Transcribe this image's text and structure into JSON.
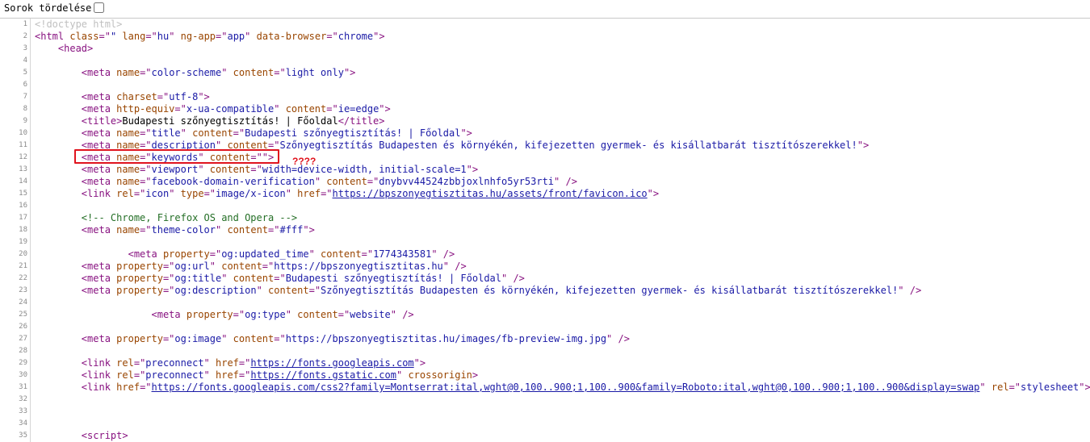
{
  "toolbar": {
    "wrap_label": "Sorok tördelése"
  },
  "lines": [
    [
      [
        "dt",
        "<!doctype html>"
      ]
    ],
    [
      [
        "t",
        "<html "
      ],
      [
        "an",
        "class"
      ],
      [
        "t",
        "=\""
      ],
      [
        "av",
        "\""
      ],
      [
        "t",
        " "
      ],
      [
        "an",
        "lang"
      ],
      [
        "t",
        "=\""
      ],
      [
        "av",
        "hu"
      ],
      [
        "t",
        "\" "
      ],
      [
        "an",
        "ng-app"
      ],
      [
        "t",
        "=\""
      ],
      [
        "av",
        "app"
      ],
      [
        "t",
        "\" "
      ],
      [
        "an",
        "data-browser"
      ],
      [
        "t",
        "=\""
      ],
      [
        "av",
        "chrome"
      ],
      [
        "t",
        "\">"
      ]
    ],
    [
      [
        "tx",
        "    "
      ],
      [
        "t",
        "<head>"
      ]
    ],
    [],
    [
      [
        "tx",
        "        "
      ],
      [
        "t",
        "<meta "
      ],
      [
        "an",
        "name"
      ],
      [
        "t",
        "=\""
      ],
      [
        "av",
        "color-scheme"
      ],
      [
        "t",
        "\" "
      ],
      [
        "an",
        "content"
      ],
      [
        "t",
        "=\""
      ],
      [
        "av",
        "light only"
      ],
      [
        "t",
        "\">"
      ]
    ],
    [],
    [
      [
        "tx",
        "        "
      ],
      [
        "t",
        "<meta "
      ],
      [
        "an",
        "charset"
      ],
      [
        "t",
        "=\""
      ],
      [
        "av",
        "utf-8"
      ],
      [
        "t",
        "\">"
      ]
    ],
    [
      [
        "tx",
        "        "
      ],
      [
        "t",
        "<meta "
      ],
      [
        "an",
        "http-equiv"
      ],
      [
        "t",
        "=\""
      ],
      [
        "av",
        "x-ua-compatible"
      ],
      [
        "t",
        "\" "
      ],
      [
        "an",
        "content"
      ],
      [
        "t",
        "=\""
      ],
      [
        "av",
        "ie=edge"
      ],
      [
        "t",
        "\">"
      ]
    ],
    [
      [
        "tx",
        "        "
      ],
      [
        "t",
        "<title>"
      ],
      [
        "tx",
        "Budapesti szőnyegtisztítás! | Főoldal"
      ],
      [
        "t",
        "</title>"
      ]
    ],
    [
      [
        "tx",
        "        "
      ],
      [
        "t",
        "<meta "
      ],
      [
        "an",
        "name"
      ],
      [
        "t",
        "=\""
      ],
      [
        "av",
        "title"
      ],
      [
        "t",
        "\" "
      ],
      [
        "an",
        "content"
      ],
      [
        "t",
        "=\""
      ],
      [
        "av",
        "Budapesti szőnyegtisztítás! | Főoldal"
      ],
      [
        "t",
        "\">"
      ]
    ],
    [
      [
        "tx",
        "        "
      ],
      [
        "t",
        "<meta "
      ],
      [
        "an",
        "name"
      ],
      [
        "t",
        "=\""
      ],
      [
        "av",
        "description"
      ],
      [
        "t",
        "\" "
      ],
      [
        "an",
        "content"
      ],
      [
        "t",
        "=\""
      ],
      [
        "av",
        "Szőnyegtisztítás Budapesten és környékén, kifejezetten gyermek- és kisállatbarát tisztítószerekkel!"
      ],
      [
        "t",
        "\">"
      ]
    ],
    [
      [
        "tx",
        "        "
      ],
      [
        "t",
        "<meta "
      ],
      [
        "an",
        "name"
      ],
      [
        "t",
        "=\""
      ],
      [
        "av",
        "keywords"
      ],
      [
        "t",
        "\" "
      ],
      [
        "an",
        "content"
      ],
      [
        "t",
        "=\""
      ],
      [
        "av",
        ""
      ],
      [
        "t",
        "\">"
      ]
    ],
    [
      [
        "tx",
        "        "
      ],
      [
        "t",
        "<meta "
      ],
      [
        "an",
        "name"
      ],
      [
        "t",
        "=\""
      ],
      [
        "av",
        "viewport"
      ],
      [
        "t",
        "\" "
      ],
      [
        "an",
        "content"
      ],
      [
        "t",
        "=\""
      ],
      [
        "av",
        "width=device-width, initial-scale=1"
      ],
      [
        "t",
        "\">"
      ]
    ],
    [
      [
        "tx",
        "        "
      ],
      [
        "t",
        "<meta "
      ],
      [
        "an",
        "name"
      ],
      [
        "t",
        "=\""
      ],
      [
        "av",
        "facebook-domain-verification"
      ],
      [
        "t",
        "\" "
      ],
      [
        "an",
        "content"
      ],
      [
        "t",
        "=\""
      ],
      [
        "av",
        "dnybvv44524zbbjoxlnhfo5yr53rti"
      ],
      [
        "t",
        "\" />"
      ]
    ],
    [
      [
        "tx",
        "        "
      ],
      [
        "t",
        "<link "
      ],
      [
        "an",
        "rel"
      ],
      [
        "t",
        "=\""
      ],
      [
        "av",
        "icon"
      ],
      [
        "t",
        "\" "
      ],
      [
        "an",
        "type"
      ],
      [
        "t",
        "=\""
      ],
      [
        "av",
        "image/x-icon"
      ],
      [
        "t",
        "\" "
      ],
      [
        "an",
        "href"
      ],
      [
        "t",
        "=\""
      ],
      [
        "lk",
        "https://bpszonyegtisztitas.hu/assets/front/favicon.ico"
      ],
      [
        "t",
        "\">"
      ]
    ],
    [],
    [
      [
        "tx",
        "        "
      ],
      [
        "c",
        "<!-- Chrome, Firefox OS and Opera -->"
      ]
    ],
    [
      [
        "tx",
        "        "
      ],
      [
        "t",
        "<meta "
      ],
      [
        "an",
        "name"
      ],
      [
        "t",
        "=\""
      ],
      [
        "av",
        "theme-color"
      ],
      [
        "t",
        "\" "
      ],
      [
        "an",
        "content"
      ],
      [
        "t",
        "=\""
      ],
      [
        "av",
        "#fff"
      ],
      [
        "t",
        "\">"
      ]
    ],
    [],
    [
      [
        "tx",
        "                "
      ],
      [
        "t",
        "<meta "
      ],
      [
        "an",
        "property"
      ],
      [
        "t",
        "=\""
      ],
      [
        "av",
        "og:updated_time"
      ],
      [
        "t",
        "\" "
      ],
      [
        "an",
        "content"
      ],
      [
        "t",
        "=\""
      ],
      [
        "av",
        "1774343581"
      ],
      [
        "t",
        "\" />"
      ]
    ],
    [
      [
        "tx",
        "        "
      ],
      [
        "t",
        "<meta "
      ],
      [
        "an",
        "property"
      ],
      [
        "t",
        "=\""
      ],
      [
        "av",
        "og:url"
      ],
      [
        "t",
        "\" "
      ],
      [
        "an",
        "content"
      ],
      [
        "t",
        "=\""
      ],
      [
        "av",
        "https://bpszonyegtisztitas.hu"
      ],
      [
        "t",
        "\" />"
      ]
    ],
    [
      [
        "tx",
        "        "
      ],
      [
        "t",
        "<meta "
      ],
      [
        "an",
        "property"
      ],
      [
        "t",
        "=\""
      ],
      [
        "av",
        "og:title"
      ],
      [
        "t",
        "\" "
      ],
      [
        "an",
        "content"
      ],
      [
        "t",
        "=\""
      ],
      [
        "av",
        "Budapesti szőnyegtisztítás! | Főoldal"
      ],
      [
        "t",
        "\" />"
      ]
    ],
    [
      [
        "tx",
        "        "
      ],
      [
        "t",
        "<meta "
      ],
      [
        "an",
        "property"
      ],
      [
        "t",
        "=\""
      ],
      [
        "av",
        "og:description"
      ],
      [
        "t",
        "\" "
      ],
      [
        "an",
        "content"
      ],
      [
        "t",
        "=\""
      ],
      [
        "av",
        "Szőnyegtisztítás Budapesten és környékén, kifejezetten gyermek- és kisállatbarát tisztítószerekkel!"
      ],
      [
        "t",
        "\" />"
      ]
    ],
    [],
    [
      [
        "tx",
        "                    "
      ],
      [
        "t",
        "<meta "
      ],
      [
        "an",
        "property"
      ],
      [
        "t",
        "=\""
      ],
      [
        "av",
        "og:type"
      ],
      [
        "t",
        "\" "
      ],
      [
        "an",
        "content"
      ],
      [
        "t",
        "=\""
      ],
      [
        "av",
        "website"
      ],
      [
        "t",
        "\" />"
      ]
    ],
    [],
    [
      [
        "tx",
        "        "
      ],
      [
        "t",
        "<meta "
      ],
      [
        "an",
        "property"
      ],
      [
        "t",
        "=\""
      ],
      [
        "av",
        "og:image"
      ],
      [
        "t",
        "\" "
      ],
      [
        "an",
        "content"
      ],
      [
        "t",
        "=\""
      ],
      [
        "av",
        "https://bpszonyegtisztitas.hu/images/fb-preview-img.jpg"
      ],
      [
        "t",
        "\" />"
      ]
    ],
    [],
    [
      [
        "tx",
        "        "
      ],
      [
        "t",
        "<link "
      ],
      [
        "an",
        "rel"
      ],
      [
        "t",
        "=\""
      ],
      [
        "av",
        "preconnect"
      ],
      [
        "t",
        "\" "
      ],
      [
        "an",
        "href"
      ],
      [
        "t",
        "=\""
      ],
      [
        "lk",
        "https://fonts.googleapis.com"
      ],
      [
        "t",
        "\">"
      ]
    ],
    [
      [
        "tx",
        "        "
      ],
      [
        "t",
        "<link "
      ],
      [
        "an",
        "rel"
      ],
      [
        "t",
        "=\""
      ],
      [
        "av",
        "preconnect"
      ],
      [
        "t",
        "\" "
      ],
      [
        "an",
        "href"
      ],
      [
        "t",
        "=\""
      ],
      [
        "lk",
        "https://fonts.gstatic.com"
      ],
      [
        "t",
        "\" "
      ],
      [
        "an",
        "crossorigin"
      ],
      [
        "t",
        ">"
      ]
    ],
    [
      [
        "tx",
        "        "
      ],
      [
        "t",
        "<link "
      ],
      [
        "an",
        "href"
      ],
      [
        "t",
        "=\""
      ],
      [
        "lk",
        "https://fonts.googleapis.com/css2?family=Montserrat:ital,wght@0,100..900;1,100..900&family=Roboto:ital,wght@0,100..900;1,100..900&display=swap"
      ],
      [
        "t",
        "\" "
      ],
      [
        "an",
        "rel"
      ],
      [
        "t",
        "=\""
      ],
      [
        "av",
        "stylesheet"
      ],
      [
        "t",
        "\">"
      ]
    ],
    [],
    [],
    [],
    [
      [
        "tx",
        "        "
      ],
      [
        "t",
        "<script>"
      ]
    ]
  ],
  "annotation": {
    "text": "????"
  },
  "colors": {
    "tag": "#881280",
    "attr_name": "#994500",
    "attr_value": "#1a1aa6",
    "comment": "#236e25",
    "doctype": "#c0c0c0",
    "highlight": "#e0141e"
  }
}
